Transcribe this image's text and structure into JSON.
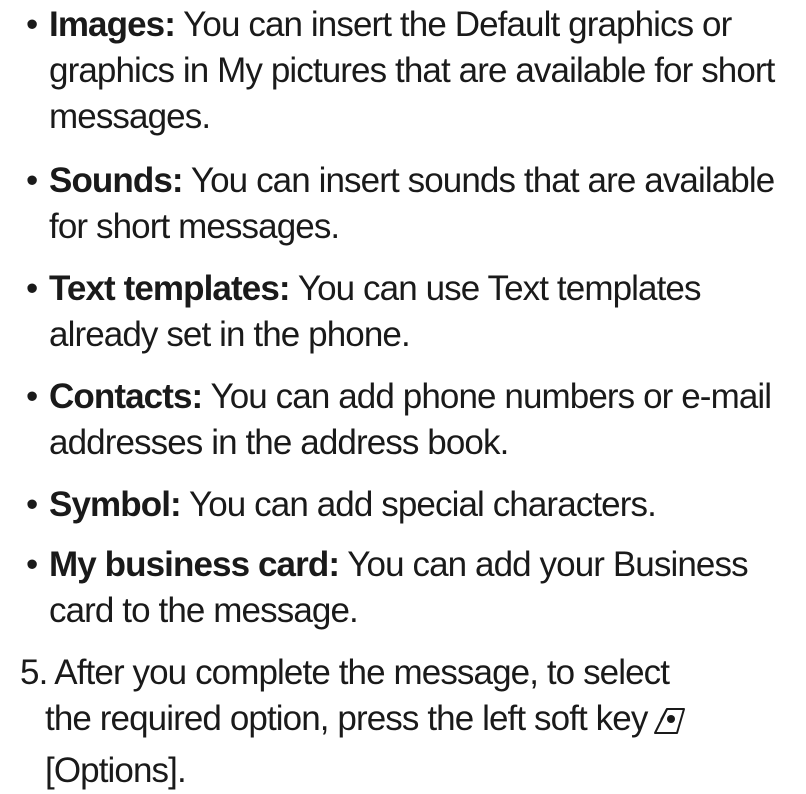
{
  "bullets": [
    {
      "bullet": "•",
      "term": "Images:",
      "lines": [
        " You can insert the Default graphics or",
        "graphics in My pictures that are available for short",
        "messages."
      ]
    },
    {
      "bullet": "•",
      "term": "Sounds:",
      "lines": [
        " You can insert sounds that are available",
        "for short messages."
      ]
    },
    {
      "bullet": "•",
      "term": "Text templates:",
      "lines": [
        " You can use Text templates",
        "already set in the phone."
      ]
    },
    {
      "bullet": "•",
      "term": "Contacts:",
      "lines": [
        " You can add phone numbers or e-mail",
        "addresses in the address book."
      ]
    },
    {
      "bullet": "•",
      "term": "Symbol:",
      "lines": [
        " You can add special characters."
      ]
    },
    {
      "bullet": "•",
      "term": "My business card:",
      "lines": [
        " You can add your Business",
        "card to the message."
      ]
    }
  ],
  "step": {
    "lines": [
      "5. After you complete the message, to select",
      "the required option, press the left soft key",
      "[Options]."
    ],
    "icon": "left-soft-key-icon"
  }
}
